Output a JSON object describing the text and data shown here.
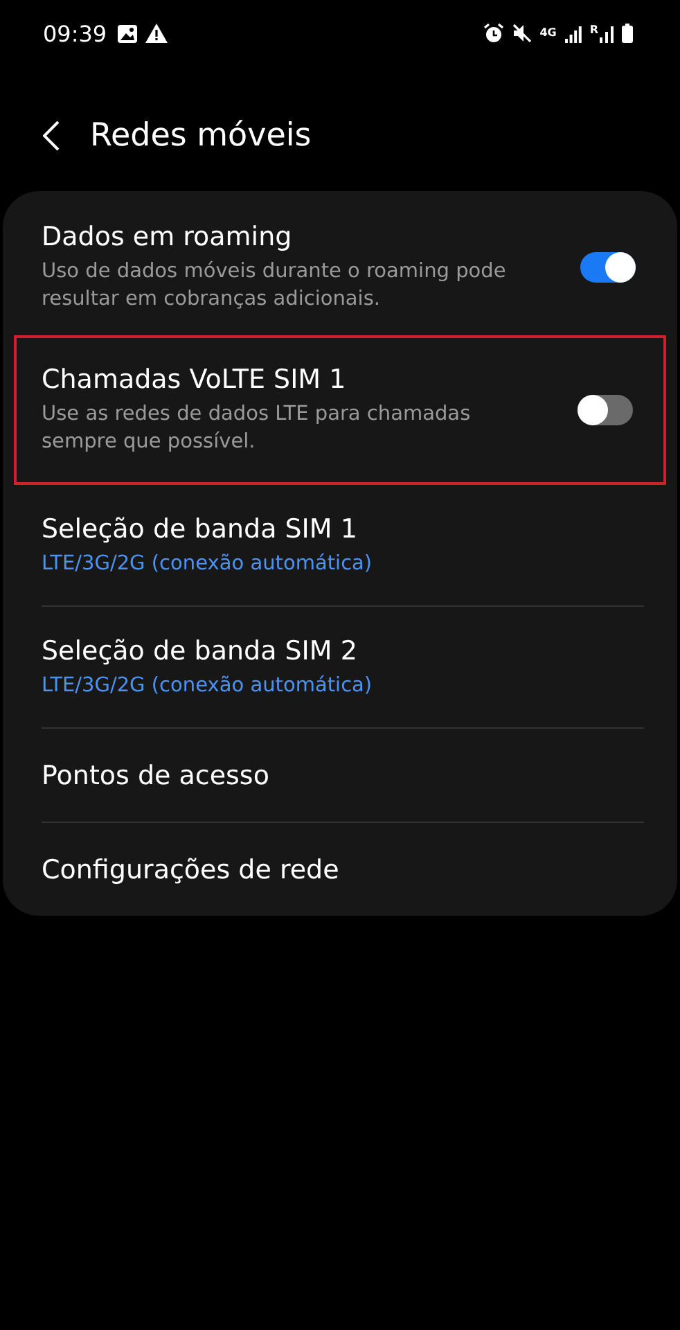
{
  "status_bar": {
    "time": "09:39",
    "network_type": "4G",
    "roaming": "R"
  },
  "header": {
    "title": "Redes móveis"
  },
  "items": [
    {
      "kind": "toggle",
      "title": "Dados em roaming",
      "subtitle": "Uso de dados móveis durante o roaming pode resultar em cobranças adicionais.",
      "on": true,
      "highlighted": false
    },
    {
      "kind": "toggle",
      "title": "Chamadas VoLTE SIM 1",
      "subtitle": "Use as redes de dados LTE para chamadas sempre que possível.",
      "on": false,
      "highlighted": true
    },
    {
      "kind": "link",
      "title": "Seleção de banda SIM 1",
      "subtitle": "LTE/3G/2G (conexão automática)"
    },
    {
      "kind": "link",
      "title": "Seleção de banda SIM 2",
      "subtitle": "LTE/3G/2G (conexão automática)"
    },
    {
      "kind": "link",
      "title": "Pontos de acesso"
    },
    {
      "kind": "link",
      "title": "Configurações de rede"
    }
  ]
}
